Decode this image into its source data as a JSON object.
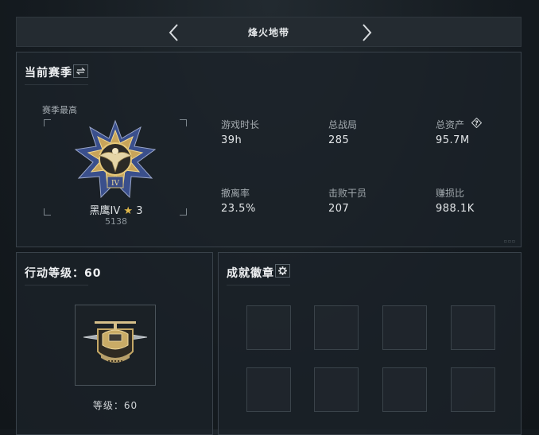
{
  "header": {
    "title": "烽火地带"
  },
  "season": {
    "title": "当前赛季",
    "peak_label": "赛季最高",
    "rank_name": "黑鹰IV",
    "rank_stars": "3",
    "rank_score": "5138",
    "stats": [
      {
        "label": "游戏时长",
        "value": "39h"
      },
      {
        "label": "总战局",
        "value": "285"
      },
      {
        "label": "总资产",
        "value": "95.7M"
      },
      {
        "label": "撤离率",
        "value": "23.5%"
      },
      {
        "label": "击败干员",
        "value": "207"
      },
      {
        "label": "赚损比",
        "value": "988.1K"
      }
    ],
    "colors": {
      "medal_gold": "#c8a45a",
      "medal_blue": "#2e3f7a",
      "star": "#e0b84a"
    }
  },
  "operation": {
    "title": "行动等级：60",
    "level_text": "等级：60"
  },
  "achievements": {
    "title": "成就徽章",
    "slots": 8
  },
  "icons": {
    "prev": "chevron-left-icon",
    "next": "chevron-right-icon",
    "switch": "swap-icon",
    "settings": "gear-icon",
    "help": "question-icon"
  }
}
